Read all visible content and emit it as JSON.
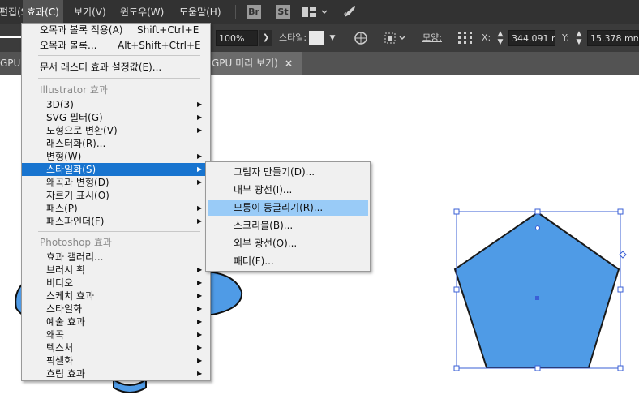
{
  "menubar": {
    "items": [
      "편집(S)",
      "효과(C)",
      "보기(V)",
      "윈도우(W)",
      "도움말(H)"
    ],
    "badges": [
      "Br",
      "St"
    ]
  },
  "controlbar": {
    "opacity": "100%",
    "style_label": "스타일:",
    "shape_label": "모양:",
    "x_label": "X:",
    "x_value": "344.091 m",
    "y_label": "Y:",
    "y_value": "15.378 mm"
  },
  "tabbar": {
    "tab_left": "GPU",
    "tab_active": "GPU 미리 보기)",
    "close": "×"
  },
  "menu": {
    "apply_last": "오목과 볼록 적용(A)",
    "apply_last_shortcut": "Shift+Ctrl+E",
    "last_effect": "오목과 볼록...",
    "last_effect_shortcut": "Alt+Shift+Ctrl+E",
    "raster_settings": "문서 래스터 효과 설정값(E)...",
    "illustrator_section": "Illustrator 효과",
    "illustrator_items": [
      "3D(3)",
      "SVG 필터(G)",
      "도형으로 변환(V)",
      "래스터화(R)...",
      "변형(W)",
      "스타일화(S)",
      "왜곡과 변형(D)",
      "자르기 표시(O)",
      "패스(P)",
      "패스파인더(F)"
    ],
    "photoshop_section": "Photoshop 효과",
    "photoshop_items": [
      "효과 갤러리...",
      "브러시 획",
      "비디오",
      "스케치 효과",
      "스타일화",
      "예술 효과",
      "왜곡",
      "텍스처",
      "픽셀화",
      "흐림 효과"
    ]
  },
  "submenu": {
    "items": [
      "그림자 만들기(D)...",
      "내부 광선(I)...",
      "모퉁이 둥글리기(R)...",
      "스크리블(B)...",
      "외부 광선(O)...",
      "패더(F)..."
    ]
  },
  "colors": {
    "shape_fill": "#4f9be6",
    "selection": "#3a5fd6",
    "menu_highlight": "#1874cf",
    "submenu_highlight": "#99cbf7"
  }
}
